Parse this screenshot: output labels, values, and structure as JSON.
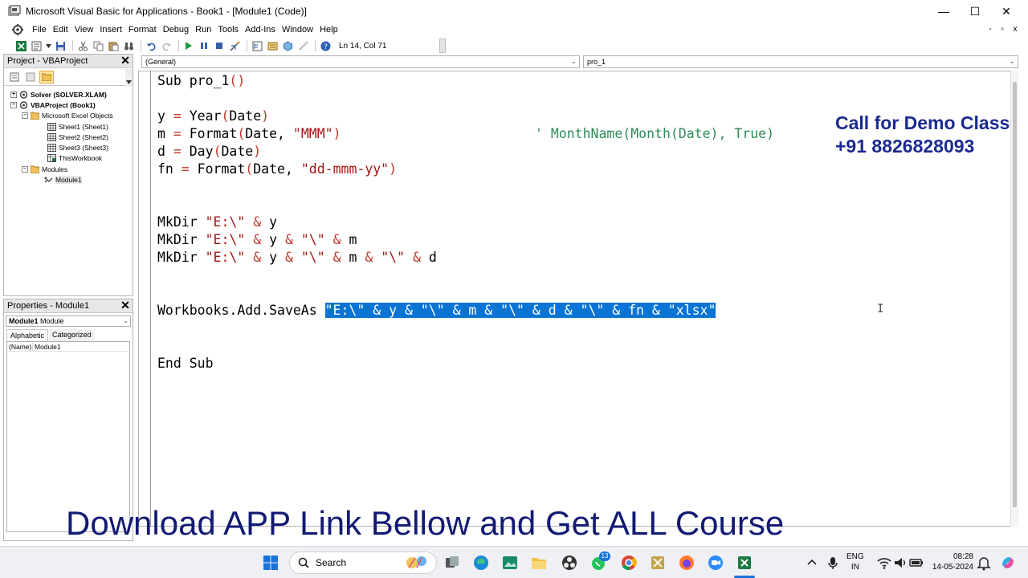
{
  "window": {
    "title": "Microsoft Visual Basic for Applications - Book1 - [Module1 (Code)]",
    "minimize": "—",
    "maximize": "☐",
    "close": "✕"
  },
  "menu": {
    "items": [
      "File",
      "Edit",
      "View",
      "Insert",
      "Format",
      "Debug",
      "Run",
      "Tools",
      "Add-Ins",
      "Window",
      "Help"
    ],
    "mdi_min": "-",
    "mdi_restore": "▫",
    "mdi_close": "x"
  },
  "toolbar": {
    "status": "Ln 14, Col 71"
  },
  "project_pane": {
    "title": "Project - VBAProject",
    "tree": [
      {
        "label": "Solver (SOLVER.XLAM)",
        "bold": true
      },
      {
        "label": "VBAProject (Book1)",
        "bold": true
      },
      {
        "label": "Microsoft Excel Objects",
        "bold": false
      },
      {
        "label": "Sheet1 (Sheet1)",
        "bold": false
      },
      {
        "label": "Sheet2 (Sheet2)",
        "bold": false
      },
      {
        "label": "Sheet3 (Sheet3)",
        "bold": false
      },
      {
        "label": "ThisWorkbook",
        "bold": false
      },
      {
        "label": "Modules",
        "bold": false
      },
      {
        "label": "Module1",
        "bold": false
      }
    ]
  },
  "properties_pane": {
    "title": "Properties - Module1",
    "object_name": "Module1",
    "object_type": "Module",
    "tab_alphabetic": "Alphabetic",
    "tab_categorized": "Categorized",
    "rows": [
      {
        "key": "(Name)",
        "value": "Module1"
      }
    ]
  },
  "code_window": {
    "object_combo": "(General)",
    "procedure_combo": "pro_1",
    "lines": {
      "l1_a": "Sub pro_1",
      "l1_b": "()",
      "l2_a": "y ",
      "l2_b": "=",
      "l2_c": " Year",
      "l2_d": "(",
      "l2_e": "Date",
      "l2_f": ")",
      "l3_a": "m ",
      "l3_b": "=",
      "l3_c": " Format",
      "l3_d": "(",
      "l3_e": "Date, ",
      "l3_f": "\"MMM\"",
      "l3_g": ")",
      "l3_comment": "' MonthName(Month(Date), True)",
      "l4_a": "d ",
      "l4_b": "=",
      "l4_c": " Day",
      "l4_d": "(",
      "l4_e": "Date",
      "l4_f": ")",
      "l5_a": "fn ",
      "l5_b": "=",
      "l5_c": " Format",
      "l5_d": "(",
      "l5_e": "Date, ",
      "l5_f": "\"dd-mmm-yy\"",
      "l5_g": ")",
      "mk1_a": "MkDir ",
      "mk1_b": "\"E:\\\"",
      "mk1_c": " & ",
      "mk1_d": "y",
      "mk2_a": "MkDir ",
      "mk2_b": "\"E:\\\"",
      "mk2_c": " & ",
      "mk2_d": "y",
      "mk2_e": " & ",
      "mk2_f": "\"\\\"",
      "mk2_g": " & ",
      "mk2_h": "m",
      "mk3_a": "MkDir ",
      "mk3_b": "\"E:\\\"",
      "mk3_c": " & ",
      "mk3_d": "y",
      "mk3_e": " & ",
      "mk3_f": "\"\\\"",
      "mk3_g": " & ",
      "mk3_h": "m",
      "mk3_i": " & ",
      "mk3_j": "\"\\\"",
      "mk3_k": " & ",
      "mk3_l": "d",
      "wb_a": "Workbooks.Add.SaveAs ",
      "wb_sel": "\"E:\\\" & y & \"\\\" & m & \"\\\" & d & \"\\\" & fn & \"xlsx\"",
      "end": "End Sub"
    }
  },
  "overlays": {
    "demo_line1": "Call for Demo Class",
    "demo_line2": "+91 8826828093",
    "banner": "Download APP Link Bellow and Get ALL Course"
  },
  "taskbar": {
    "search_placeholder": "Search",
    "lang_line1": "ENG",
    "lang_line2": "IN",
    "time": "08:28",
    "date": "14-05-2024",
    "whatsapp_badge": "13"
  },
  "colors": {
    "selection": "#0a74d4",
    "string": "#a31515",
    "comment": "#2e8b57",
    "overlay_text": "#1a2a8e"
  }
}
